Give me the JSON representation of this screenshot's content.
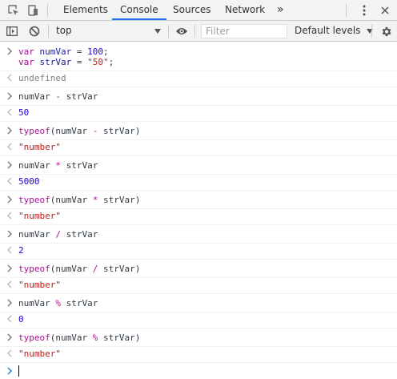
{
  "tabs": [
    "Elements",
    "Console",
    "Sources",
    "Network"
  ],
  "active_tab": "Console",
  "more_tabs_glyph": "»",
  "toolbar": {
    "context": "top",
    "filter_placeholder": "Filter",
    "levels_label": "Default levels"
  },
  "colors": {
    "keyword": "#aa0d91",
    "number": "#1c00cf",
    "string": "#c41a16",
    "active_tab_underline": "#1a73e8"
  },
  "console": [
    {
      "kind": "input",
      "lines": [
        [
          {
            "t": "var",
            "c": "kw"
          },
          {
            "t": " numVar ",
            "c": "var"
          },
          {
            "t": "= ",
            "c": "op"
          },
          {
            "t": "100",
            "c": "num"
          },
          {
            "t": ";",
            "c": "op"
          }
        ],
        [
          {
            "t": "var",
            "c": "kw"
          },
          {
            "t": " strVar ",
            "c": "var"
          },
          {
            "t": "= ",
            "c": "op"
          },
          {
            "t": "\"50\"",
            "c": "str"
          },
          {
            "t": ";",
            "c": "op"
          }
        ]
      ]
    },
    {
      "kind": "output",
      "text": "undefined",
      "type": "undef"
    },
    {
      "kind": "input",
      "lines": [
        [
          {
            "t": "numVar ",
            "c": "plain"
          },
          {
            "t": "-",
            "c": "kw"
          },
          {
            "t": " strVar",
            "c": "plain"
          }
        ]
      ]
    },
    {
      "kind": "output",
      "text": "50",
      "type": "num"
    },
    {
      "kind": "input",
      "lines": [
        [
          {
            "t": "typeof",
            "c": "kw"
          },
          {
            "t": "(numVar ",
            "c": "plain"
          },
          {
            "t": "-",
            "c": "kw"
          },
          {
            "t": " strVar)",
            "c": "plain"
          }
        ]
      ]
    },
    {
      "kind": "output",
      "text": "\"number\"",
      "type": "str"
    },
    {
      "kind": "input",
      "lines": [
        [
          {
            "t": "numVar ",
            "c": "plain"
          },
          {
            "t": "*",
            "c": "kw"
          },
          {
            "t": " strVar",
            "c": "plain"
          }
        ]
      ]
    },
    {
      "kind": "output",
      "text": "5000",
      "type": "num"
    },
    {
      "kind": "input",
      "lines": [
        [
          {
            "t": "typeof",
            "c": "kw"
          },
          {
            "t": "(numVar ",
            "c": "plain"
          },
          {
            "t": "*",
            "c": "kw"
          },
          {
            "t": " strVar)",
            "c": "plain"
          }
        ]
      ]
    },
    {
      "kind": "output",
      "text": "\"number\"",
      "type": "str"
    },
    {
      "kind": "input",
      "lines": [
        [
          {
            "t": "numVar ",
            "c": "plain"
          },
          {
            "t": "/",
            "c": "kw"
          },
          {
            "t": " strVar",
            "c": "plain"
          }
        ]
      ]
    },
    {
      "kind": "output",
      "text": "2",
      "type": "num"
    },
    {
      "kind": "input",
      "lines": [
        [
          {
            "t": "typeof",
            "c": "kw"
          },
          {
            "t": "(numVar ",
            "c": "plain"
          },
          {
            "t": "/",
            "c": "kw"
          },
          {
            "t": " strVar)",
            "c": "plain"
          }
        ]
      ]
    },
    {
      "kind": "output",
      "text": "\"number\"",
      "type": "str"
    },
    {
      "kind": "input",
      "lines": [
        [
          {
            "t": "numVar ",
            "c": "plain"
          },
          {
            "t": "%",
            "c": "kw"
          },
          {
            "t": " strVar",
            "c": "plain"
          }
        ]
      ]
    },
    {
      "kind": "output",
      "text": "0",
      "type": "num"
    },
    {
      "kind": "input",
      "lines": [
        [
          {
            "t": "typeof",
            "c": "kw"
          },
          {
            "t": "(numVar ",
            "c": "plain"
          },
          {
            "t": "%",
            "c": "kw"
          },
          {
            "t": " strVar)",
            "c": "plain"
          }
        ]
      ]
    },
    {
      "kind": "output",
      "text": "\"number\"",
      "type": "str"
    }
  ]
}
